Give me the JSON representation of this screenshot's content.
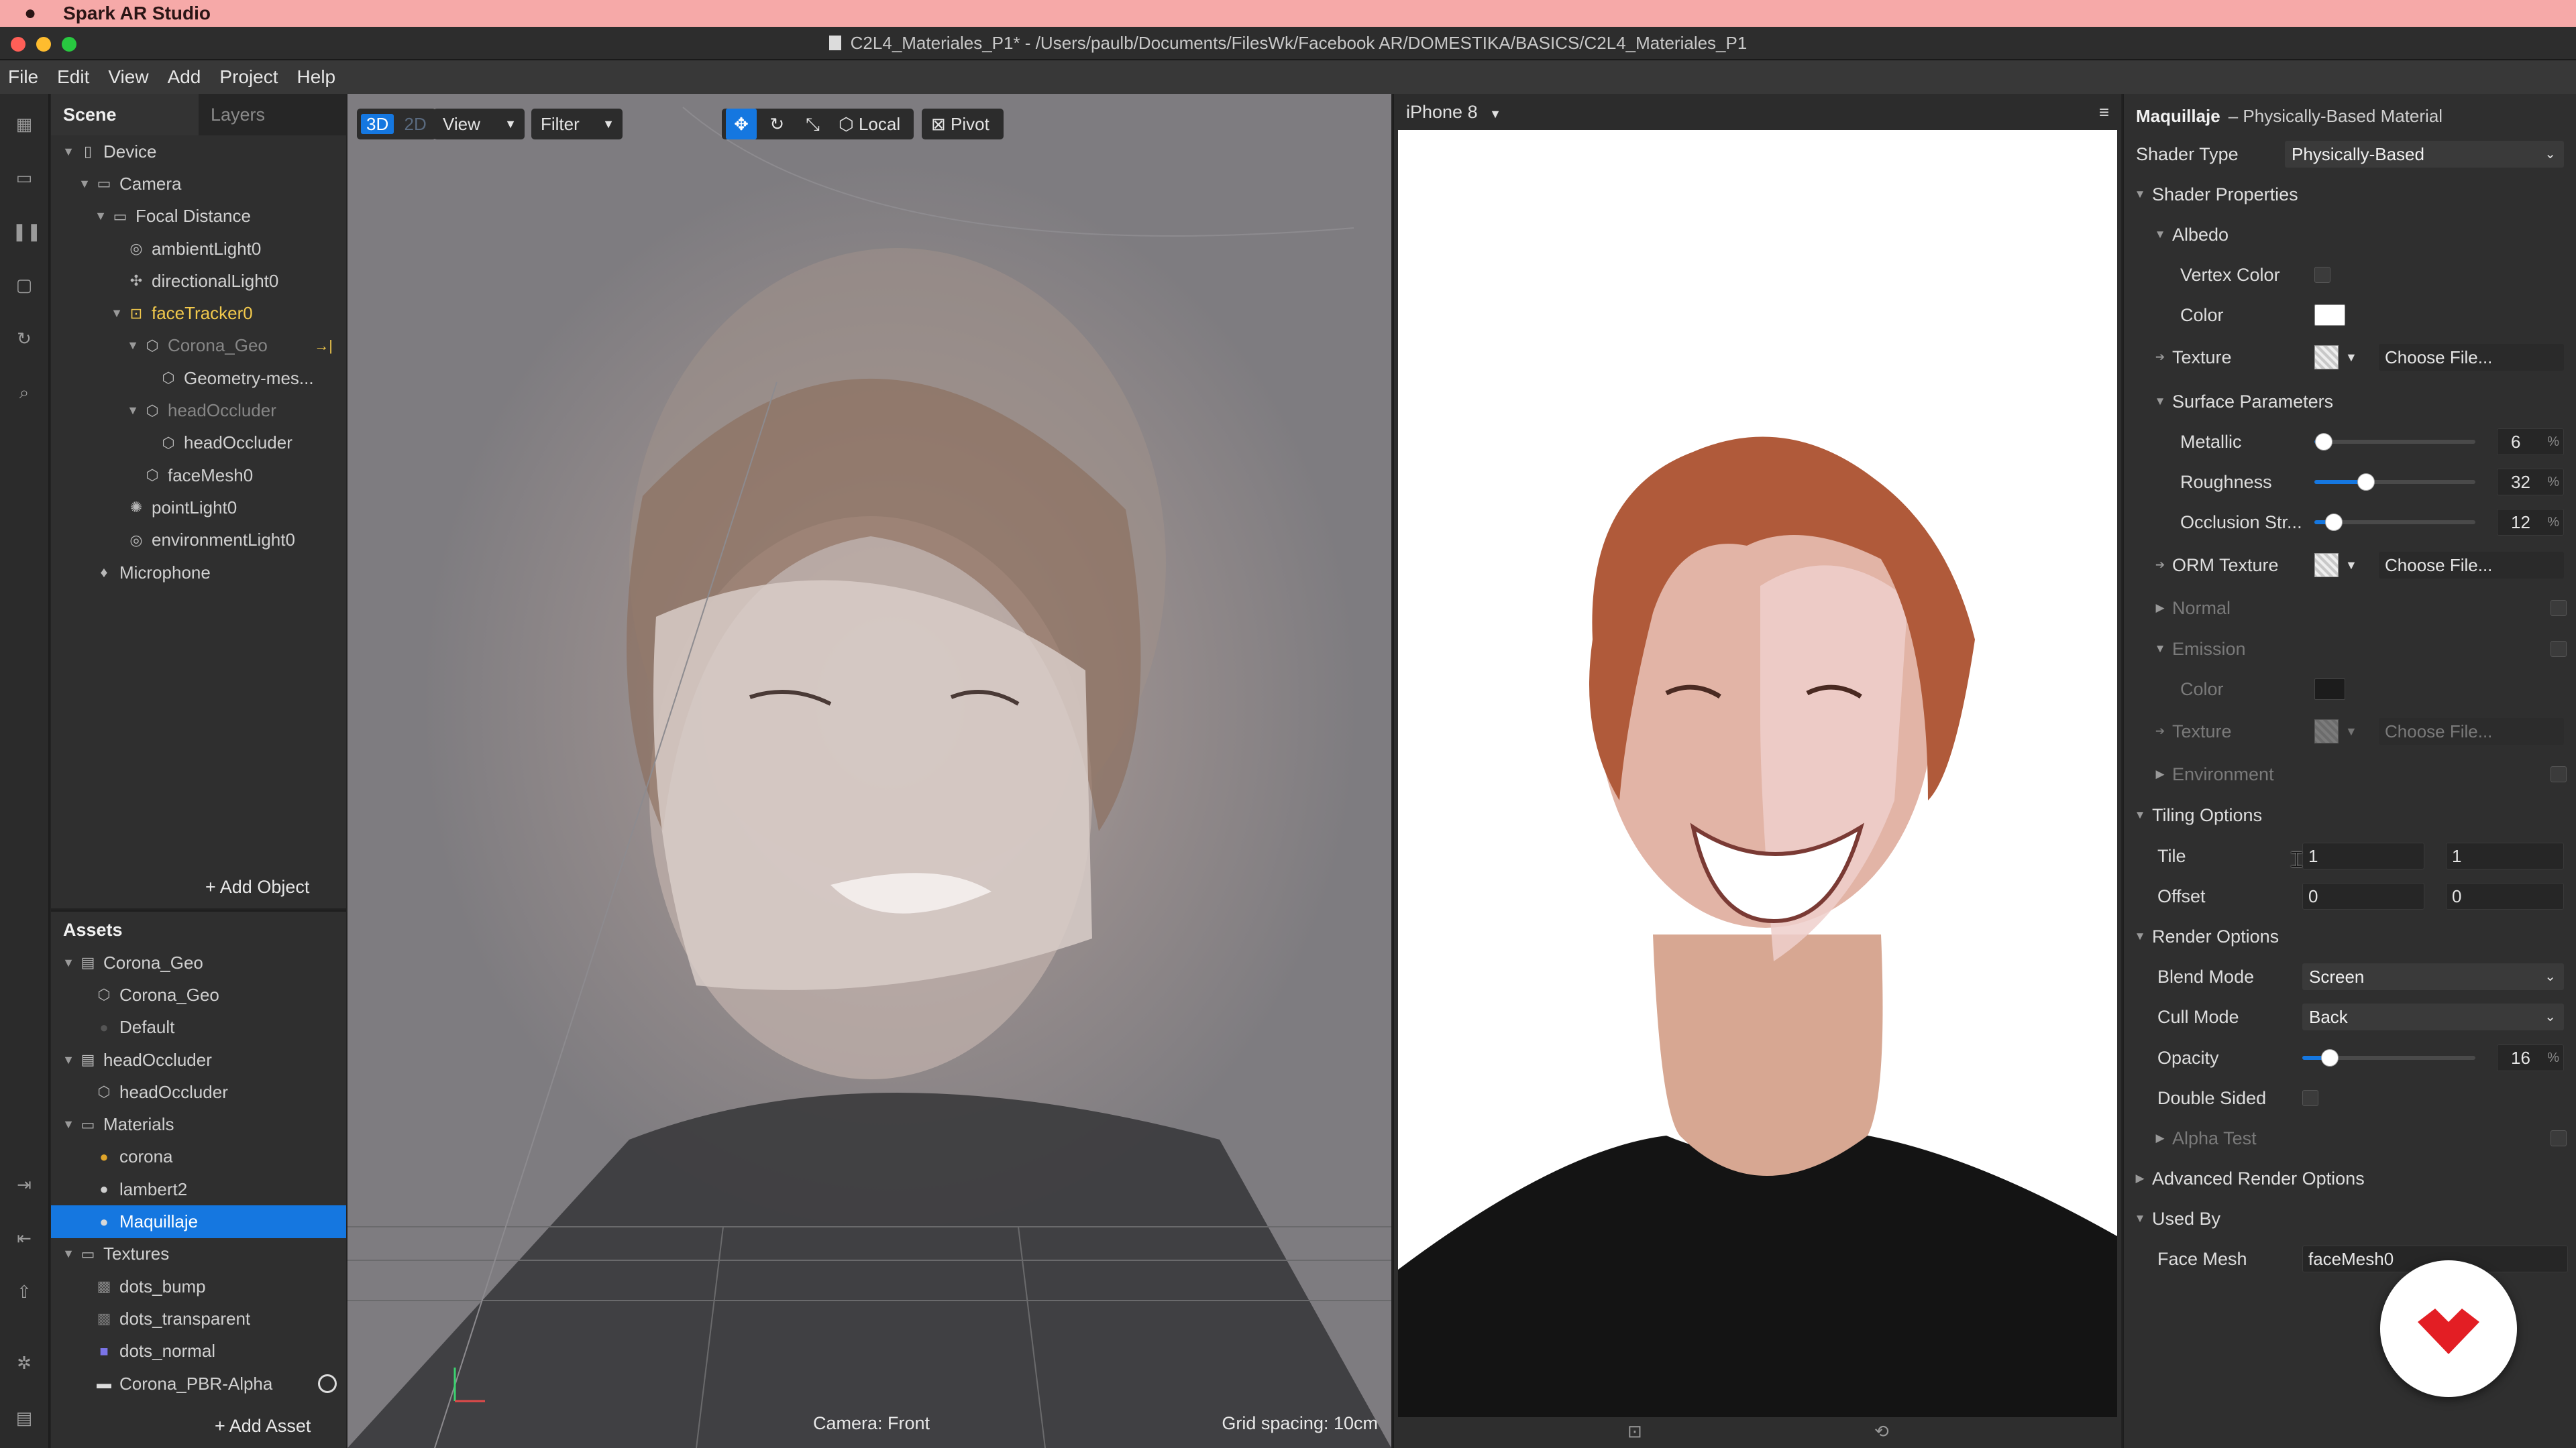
{
  "os": {
    "app_name": "Spark AR Studio"
  },
  "window": {
    "title": "C2L4_Materiales_P1* - /Users/paulb/Documents/FilesWk/Facebook AR/DOMESTIKA/BASICS/C2L4_Materiales_P1"
  },
  "menu": [
    "File",
    "Edit",
    "View",
    "Add",
    "Project",
    "Help"
  ],
  "scene": {
    "tab_scene": "Scene",
    "tab_layers": "Layers",
    "items": [
      {
        "label": "Device",
        "icon": "device-icon"
      },
      {
        "label": "Camera",
        "icon": "camera-icon"
      },
      {
        "label": "Focal Distance",
        "icon": "focal-distance-icon"
      },
      {
        "label": "ambientLight0",
        "icon": "ambient-light-icon"
      },
      {
        "label": "directionalLight0",
        "icon": "directional-light-icon"
      },
      {
        "label": "faceTracker0",
        "icon": "face-tracker-icon"
      },
      {
        "label": "Corona_Geo",
        "icon": "mesh-icon"
      },
      {
        "label": "Geometry-mes...",
        "icon": "mesh-icon"
      },
      {
        "label": "headOccluder",
        "icon": "mesh-icon"
      },
      {
        "label": "headOccluder",
        "icon": "mesh-icon"
      },
      {
        "label": "faceMesh0",
        "icon": "face-mesh-icon"
      },
      {
        "label": "pointLight0",
        "icon": "point-light-icon"
      },
      {
        "label": "environmentLight0",
        "icon": "environment-light-icon"
      },
      {
        "label": "Microphone",
        "icon": "microphone-icon"
      }
    ],
    "add_object": "+ Add Object"
  },
  "assets": {
    "title": "Assets",
    "items": [
      {
        "label": "Corona_Geo",
        "icon": "file-icon"
      },
      {
        "label": "Corona_Geo",
        "icon": "mesh-icon"
      },
      {
        "label": "Default",
        "icon": "material-sphere-icon"
      },
      {
        "label": "headOccluder",
        "icon": "file-icon"
      },
      {
        "label": "headOccluder",
        "icon": "mesh-icon"
      },
      {
        "label": "Materials",
        "icon": "folder-icon"
      },
      {
        "label": "corona",
        "icon": "material-sphere-icon"
      },
      {
        "label": "lambert2",
        "icon": "material-sphere-icon"
      },
      {
        "label": "Maquillaje",
        "icon": "material-sphere-icon"
      },
      {
        "label": "Textures",
        "icon": "folder-icon"
      },
      {
        "label": "dots_bump",
        "icon": "texture-icon"
      },
      {
        "label": "dots_transparent",
        "icon": "texture-icon"
      },
      {
        "label": "dots_normal",
        "icon": "texture-icon"
      },
      {
        "label": "Corona_PBR-Alpha",
        "icon": "texture-icon"
      }
    ],
    "add_asset": "+ Add Asset"
  },
  "viewport": {
    "mode_3d": "3D",
    "mode_2d": "2D",
    "view_label": "View",
    "filter_label": "Filter",
    "local_label": "Local",
    "pivot_label": "Pivot",
    "camera_status": "Camera: Front",
    "grid_status": "Grid spacing: 10cm"
  },
  "preview": {
    "device": "iPhone 8"
  },
  "inspector": {
    "title": "Maquillaje",
    "subtitle": "– Physically-Based Material",
    "shader_type_label": "Shader Type",
    "shader_type_value": "Physically-Based",
    "shader_properties": "Shader Properties",
    "albedo": "Albedo",
    "vertex_color": "Vertex Color",
    "color": "Color",
    "texture": "Texture",
    "choose_file": "Choose File...",
    "surface_parameters": "Surface Parameters",
    "metallic": "Metallic",
    "metallic_value": "6",
    "roughness": "Roughness",
    "roughness_value": "32",
    "occlusion": "Occlusion Str...",
    "occlusion_value": "12",
    "orm_texture": "ORM Texture",
    "normal": "Normal",
    "emission": "Emission",
    "environment": "Environment",
    "tiling_options": "Tiling Options",
    "tile": "Tile",
    "tile_x": "1",
    "tile_y": "1",
    "offset": "Offset",
    "offset_x": "0",
    "offset_y": "0",
    "render_options": "Render Options",
    "blend_mode": "Blend Mode",
    "blend_mode_value": "Screen",
    "cull_mode": "Cull Mode",
    "cull_mode_value": "Back",
    "opacity": "Opacity",
    "opacity_value": "16",
    "double_sided": "Double Sided",
    "alpha_test": "Alpha Test",
    "advanced_render_options": "Advanced Render Options",
    "used_by": "Used By",
    "face_mesh": "Face Mesh",
    "face_mesh_value": "faceMesh0",
    "percent_sign": "%"
  },
  "sliders": {
    "metallic": 0.06,
    "roughness": 0.32,
    "occlusion": 0.12,
    "opacity": 0.16
  },
  "colors": {
    "accent": "#1577e0",
    "menubar": "#f6a9a8",
    "selected_item": "#f2c94c",
    "albedo_color": "#ffffff",
    "emission_color": "#1c1c1c",
    "brand": "#e31e24"
  }
}
